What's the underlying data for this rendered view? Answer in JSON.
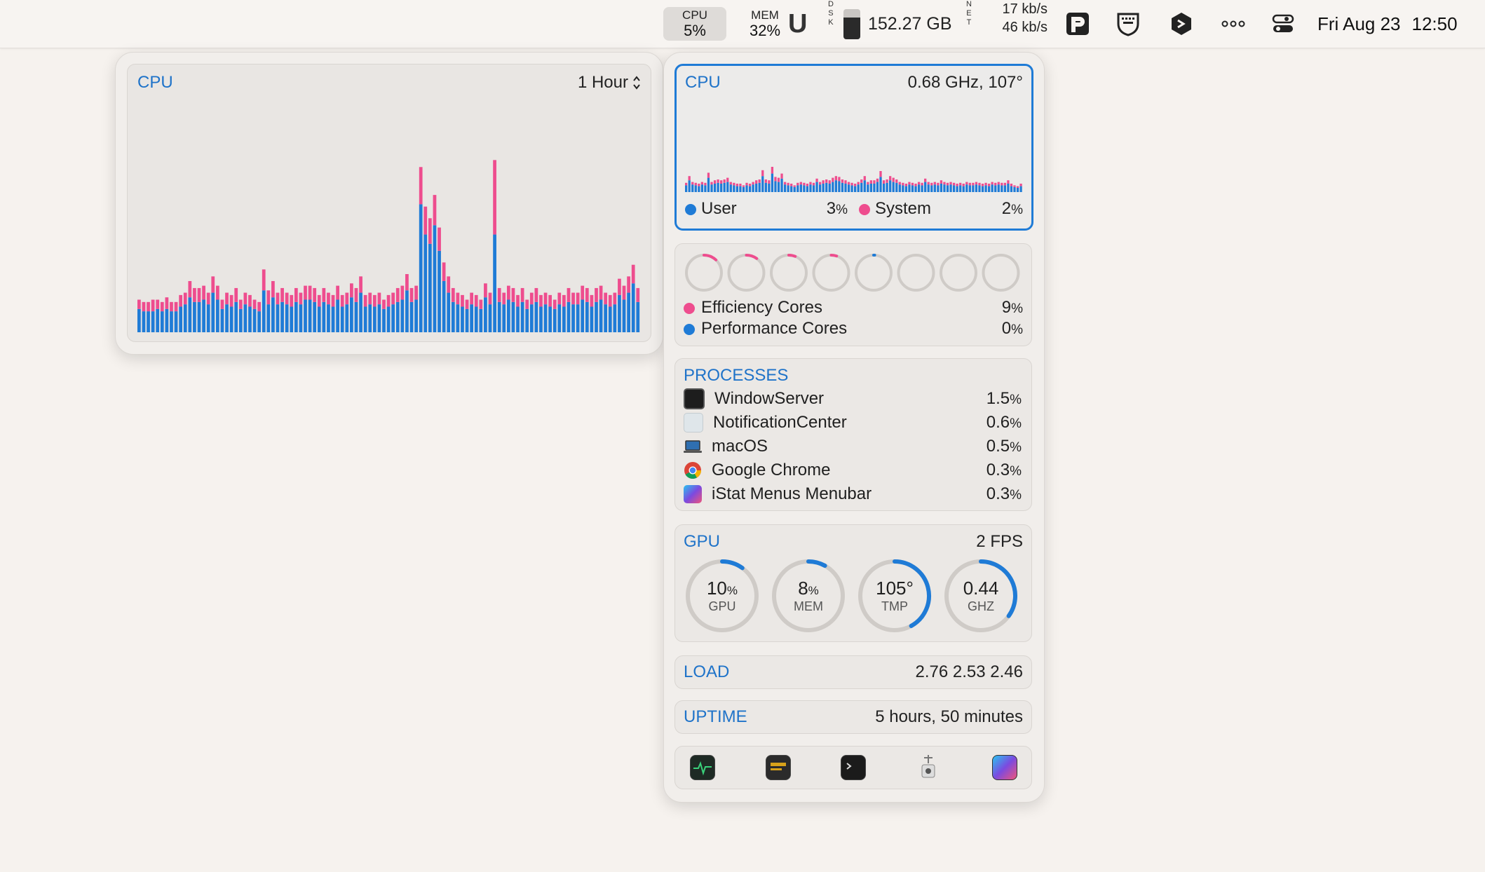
{
  "menubar": {
    "cpu_label": "CPU",
    "cpu_value": "5%",
    "mem_label": "MEM",
    "mem_value": "32%",
    "u_glyph": "U",
    "disk_letters": [
      "D",
      "S",
      "K"
    ],
    "disk_fill_fraction": 0.72,
    "disk_value": "152.27 GB",
    "net_letters": [
      "N",
      "E",
      "T"
    ],
    "net_up": "17 kb/s",
    "net_down": "46 kb/s",
    "icons": [
      "p-app-icon",
      "keyboard-shield-icon",
      "codeshot-icon",
      "more-dots-icon",
      "control-center-icon"
    ],
    "date": "Fri Aug 23",
    "time": "12:50"
  },
  "history_panel": {
    "title": "CPU",
    "range": "1 Hour",
    "range_glyph": "⌃⌄",
    "colors": {
      "user": "#1f7bd6",
      "system": "#ee4d8e"
    }
  },
  "cpu_card": {
    "title": "CPU",
    "freq_temp": "0.68 GHz, 107°",
    "user_label": "User",
    "user_value": "3",
    "system_label": "System",
    "system_value": "2",
    "percent": "%"
  },
  "cores_card": {
    "rings": [
      {
        "type": "efficiency",
        "level": 0.12
      },
      {
        "type": "efficiency",
        "level": 0.1
      },
      {
        "type": "efficiency",
        "level": 0.06
      },
      {
        "type": "efficiency",
        "level": 0.05
      },
      {
        "type": "performance",
        "level": 0.01
      },
      {
        "type": "performance",
        "level": 0
      },
      {
        "type": "performance",
        "level": 0
      },
      {
        "type": "performance",
        "level": 0
      }
    ],
    "efficiency_label": "Efficiency Cores",
    "efficiency_value": "9",
    "performance_label": "Performance Cores",
    "performance_value": "0",
    "percent": "%"
  },
  "processes_card": {
    "title": "PROCESSES",
    "items": [
      {
        "name": "WindowServer",
        "value": "1.5",
        "icon": "window-server-icon"
      },
      {
        "name": "NotificationCenter",
        "value": "0.6",
        "icon": "notification-center-icon"
      },
      {
        "name": "macOS",
        "value": "0.5",
        "icon": "macos-laptop-icon"
      },
      {
        "name": "Google Chrome",
        "value": "0.3",
        "icon": "chrome-icon"
      },
      {
        "name": "iStat Menus Menubar",
        "value": "0.3",
        "icon": "istat-menus-icon"
      }
    ],
    "percent": "%"
  },
  "gpu_card": {
    "title": "GPU",
    "fps": "2 FPS",
    "gauges": [
      {
        "value": "10",
        "unit": "%",
        "label": "GPU",
        "level": 0.1
      },
      {
        "value": "8",
        "unit": "%",
        "label": "MEM",
        "level": 0.08
      },
      {
        "value": "105°",
        "unit": "",
        "label": "TMP",
        "level": 0.42
      },
      {
        "value": "0.44",
        "unit": "",
        "label": "GHZ",
        "level": 0.35
      }
    ]
  },
  "load_card": {
    "title": "LOAD",
    "values": "2.76 2.53 2.46"
  },
  "uptime_card": {
    "title": "UPTIME",
    "value": "5 hours, 50 minutes"
  },
  "dock": {
    "icons": [
      "activity-monitor-icon",
      "console-icon",
      "terminal-icon",
      "disk-utility-icon",
      "istat-menus-app-icon"
    ]
  },
  "chart_data": [
    {
      "type": "bar",
      "stacked": true,
      "title": "CPU",
      "ylim": [
        0,
        100
      ],
      "series": [
        {
          "name": "User",
          "values": [
            10,
            9,
            9,
            9,
            10,
            9,
            10,
            9,
            9,
            11,
            12,
            15,
            13,
            13,
            14,
            12,
            17,
            14,
            10,
            12,
            11,
            13,
            10,
            12,
            11,
            10,
            9,
            18,
            12,
            15,
            12,
            13,
            12,
            11,
            13,
            12,
            14,
            14,
            13,
            11,
            13,
            12,
            11,
            14,
            11,
            12,
            15,
            13,
            17,
            11,
            12,
            11,
            12,
            10,
            11,
            12,
            13,
            14,
            18,
            13,
            14,
            55,
            42,
            38,
            46,
            35,
            22,
            17,
            13,
            12,
            11,
            10,
            12,
            11,
            10,
            15,
            12,
            42,
            13,
            12,
            14,
            13,
            11,
            13,
            10,
            12,
            13,
            11,
            12,
            11,
            10,
            12,
            11,
            13,
            12,
            12,
            14,
            13,
            11,
            13,
            14,
            12,
            11,
            12,
            16,
            14,
            17,
            21,
            13
          ]
        },
        {
          "name": "System",
          "values": [
            4,
            4,
            4,
            5,
            4,
            4,
            5,
            4,
            4,
            5,
            5,
            7,
            6,
            6,
            6,
            5,
            7,
            6,
            4,
            5,
            5,
            6,
            4,
            5,
            5,
            4,
            4,
            9,
            6,
            7,
            5,
            6,
            5,
            5,
            6,
            5,
            6,
            6,
            6,
            5,
            6,
            5,
            5,
            6,
            5,
            5,
            6,
            6,
            7,
            5,
            5,
            5,
            5,
            4,
            5,
            5,
            6,
            6,
            7,
            6,
            6,
            16,
            12,
            11,
            13,
            10,
            8,
            7,
            6,
            5,
            5,
            4,
            5,
            5,
            4,
            6,
            5,
            32,
            6,
            5,
            6,
            6,
            5,
            6,
            4,
            5,
            6,
            5,
            5,
            5,
            4,
            5,
            5,
            6,
            5,
            5,
            6,
            6,
            5,
            6,
            6,
            5,
            5,
            5,
            7,
            6,
            7,
            8,
            6
          ]
        }
      ]
    },
    {
      "type": "bar",
      "stacked": true,
      "title": "CPU",
      "ylim": [
        0,
        100
      ],
      "series": [
        {
          "name": "User",
          "values": [
            8,
            14,
            9,
            8,
            7,
            9,
            8,
            17,
            9,
            10,
            11,
            10,
            11,
            12,
            9,
            8,
            7,
            7,
            6,
            8,
            7,
            9,
            10,
            11,
            19,
            11,
            10,
            22,
            13,
            12,
            16,
            9,
            8,
            7,
            6,
            8,
            9,
            8,
            7,
            9,
            8,
            12,
            9,
            10,
            11,
            10,
            12,
            14,
            13,
            11,
            10,
            9,
            8,
            7,
            9,
            11,
            14,
            9,
            10,
            10,
            12,
            18,
            10,
            11,
            14,
            12,
            11,
            9,
            8,
            7,
            9,
            8,
            7,
            9,
            8,
            12,
            9,
            8,
            9,
            8,
            10,
            9,
            8,
            9,
            8,
            7,
            8,
            7,
            9,
            8,
            8,
            9,
            8,
            7,
            8,
            7,
            9,
            8,
            9,
            8,
            8,
            10,
            7,
            6,
            5,
            7
          ]
        },
        {
          "name": "System",
          "values": [
            3,
            5,
            3,
            3,
            3,
            3,
            3,
            6,
            3,
            4,
            4,
            4,
            4,
            5,
            3,
            3,
            3,
            3,
            2,
            3,
            3,
            3,
            4,
            4,
            7,
            4,
            4,
            8,
            5,
            5,
            6,
            3,
            3,
            3,
            2,
            3,
            3,
            3,
            3,
            3,
            3,
            4,
            3,
            4,
            4,
            4,
            5,
            5,
            5,
            4,
            4,
            3,
            3,
            3,
            3,
            4,
            5,
            3,
            4,
            4,
            4,
            7,
            4,
            4,
            5,
            5,
            4,
            3,
            3,
            3,
            3,
            3,
            3,
            3,
            3,
            4,
            3,
            3,
            3,
            3,
            4,
            3,
            3,
            3,
            3,
            3,
            3,
            3,
            3,
            3,
            3,
            3,
            3,
            3,
            3,
            3,
            3,
            3,
            3,
            3,
            3,
            4,
            3,
            2,
            2,
            3
          ]
        }
      ]
    }
  ]
}
